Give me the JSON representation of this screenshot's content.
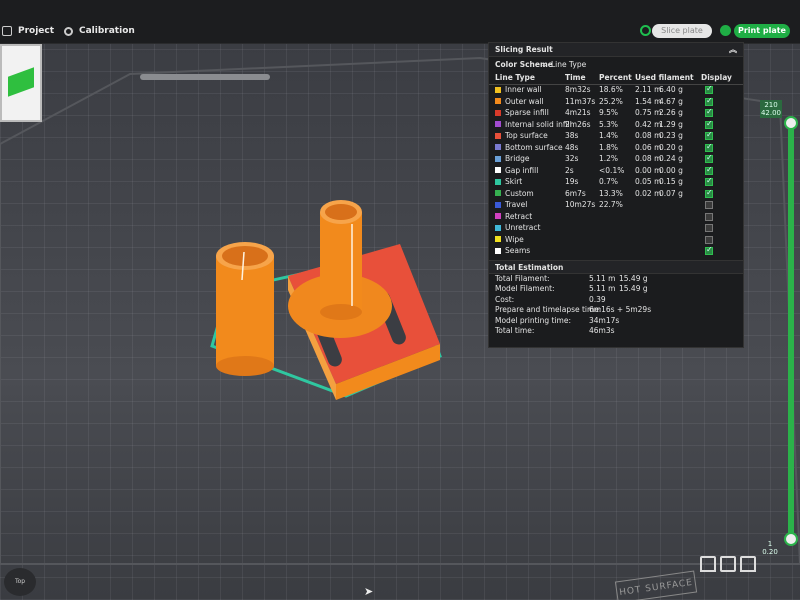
{
  "topbar": {
    "tabs": [
      {
        "label": "Project"
      },
      {
        "label": "Calibration"
      }
    ],
    "slice_label": "Slice plate",
    "print_label": "Print plate"
  },
  "slicing_result": {
    "title": "Slicing Result",
    "color_scheme_label": "Color Scheme",
    "color_scheme_value": "Line Type",
    "columns": [
      "Line Type",
      "Time",
      "Percent",
      "Used filament",
      "Display"
    ],
    "rows": [
      {
        "type": "Inner wall",
        "color": "#f0c020",
        "time": "8m32s",
        "percent": "18.6%",
        "meters": "2.11 m",
        "grams": "6.40 g",
        "display": true
      },
      {
        "type": "Outer wall",
        "color": "#f28a1c",
        "time": "11m37s",
        "percent": "25.2%",
        "meters": "1.54 m",
        "grams": "4.67 g",
        "display": true
      },
      {
        "type": "Sparse infill",
        "color": "#d83a2a",
        "time": "4m21s",
        "percent": "9.5%",
        "meters": "0.75 m",
        "grams": "2.26 g",
        "display": true
      },
      {
        "type": "Internal solid infill",
        "color": "#a24bd0",
        "time": "2m26s",
        "percent": "5.3%",
        "meters": "0.42 m",
        "grams": "1.29 g",
        "display": true
      },
      {
        "type": "Top surface",
        "color": "#e8503a",
        "time": "38s",
        "percent": "1.4%",
        "meters": "0.08 m",
        "grams": "0.23 g",
        "display": true
      },
      {
        "type": "Bottom surface",
        "color": "#7a7ad0",
        "time": "48s",
        "percent": "1.8%",
        "meters": "0.06 m",
        "grams": "0.20 g",
        "display": true
      },
      {
        "type": "Bridge",
        "color": "#6aa0d8",
        "time": "32s",
        "percent": "1.2%",
        "meters": "0.08 m",
        "grams": "0.24 g",
        "display": true
      },
      {
        "type": "Gap infill",
        "color": "#ffffff",
        "time": "2s",
        "percent": "<0.1%",
        "meters": "0.00 m",
        "grams": "0.00 g",
        "display": true
      },
      {
        "type": "Skirt",
        "color": "#2fc7a0",
        "time": "19s",
        "percent": "0.7%",
        "meters": "0.05 m",
        "grams": "0.15 g",
        "display": true
      },
      {
        "type": "Custom",
        "color": "#36b050",
        "time": "6m7s",
        "percent": "13.3%",
        "meters": "0.02 m",
        "grams": "0.07 g",
        "display": true
      },
      {
        "type": "Travel",
        "color": "#3a5ad8",
        "time": "10m27s",
        "percent": "22.7%",
        "meters": "",
        "grams": "",
        "display": false
      },
      {
        "type": "Retract",
        "color": "#d040c0",
        "time": "",
        "percent": "",
        "meters": "",
        "grams": "",
        "display": false
      },
      {
        "type": "Unretract",
        "color": "#40b8d8",
        "time": "",
        "percent": "",
        "meters": "",
        "grams": "",
        "display": false
      },
      {
        "type": "Wipe",
        "color": "#f0e020",
        "time": "",
        "percent": "",
        "meters": "",
        "grams": "",
        "display": false
      },
      {
        "type": "Seams",
        "color": "#ffffff",
        "time": "",
        "percent": "",
        "meters": "",
        "grams": "",
        "display": true
      }
    ],
    "estimation_title": "Total Estimation",
    "estimation": [
      {
        "key": "Total Filament:",
        "v1": "5.11 m",
        "v2": "15.49 g"
      },
      {
        "key": "Model Filament:",
        "v1": "5.11 m",
        "v2": "15.49 g"
      },
      {
        "key": "Cost:",
        "v1": "0.39",
        "v2": ""
      },
      {
        "key": "Prepare and timelapse time:",
        "v1": "6m16s + 5m29s",
        "v2": ""
      },
      {
        "key": "Model printing time:",
        "v1": "34m17s",
        "v2": ""
      },
      {
        "key": "Total time:",
        "v1": "46m3s",
        "v2": ""
      }
    ]
  },
  "layer_slider": {
    "top_layer": "210",
    "top_height": "42.00",
    "bottom_layer": "1",
    "bottom_height": "0.20"
  },
  "view": {
    "top_label": "Top",
    "hot_surface_label": "HOT SURFACE"
  },
  "colors": {
    "accent": "#1fae45",
    "model_orange": "#f28a1c",
    "model_red": "#e8503a",
    "skirt": "#2fc7a0"
  }
}
